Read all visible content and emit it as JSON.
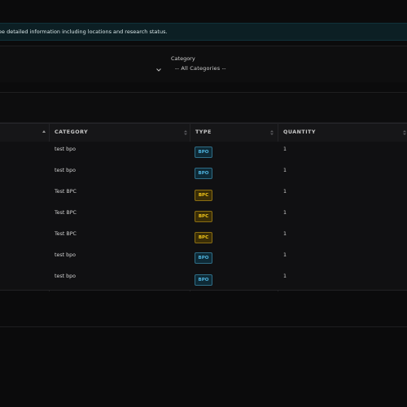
{
  "info_bar": {
    "text": "ee detailed information including locations and research status."
  },
  "filters": {
    "category_label": "Category",
    "category_value": "-- All Categories --"
  },
  "table": {
    "headers": {
      "category": "CATEGORY",
      "type": "TYPE",
      "quantity": "QUANTITY"
    },
    "rows": [
      {
        "category": "test bpo",
        "type": "BPO",
        "quantity": "1"
      },
      {
        "category": "test bpo",
        "type": "BPO",
        "quantity": "1"
      },
      {
        "category": "Test BPC",
        "type": "BPC",
        "quantity": "1"
      },
      {
        "category": "Test BPC",
        "type": "BPC",
        "quantity": "1"
      },
      {
        "category": "Test BPC",
        "type": "BPC",
        "quantity": "1"
      },
      {
        "category": "test bpo",
        "type": "BPO",
        "quantity": "1"
      },
      {
        "category": "test bpo",
        "type": "BPO",
        "quantity": "1"
      }
    ]
  },
  "colors": {
    "bpo": "#4fb3de",
    "bpc": "#f0c419",
    "info_bg": "#0c1f24"
  },
  "icons": {
    "sort": "sort-icon",
    "sort_active": "sort-ascending-icon",
    "dropdown": "chevron-down-icon"
  }
}
